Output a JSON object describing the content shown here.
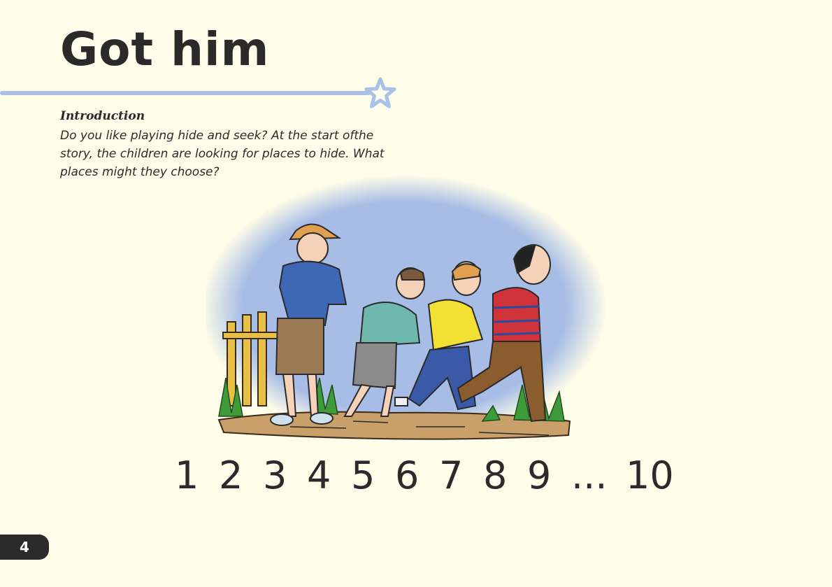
{
  "page": {
    "title": "Got him",
    "page_number": "4"
  },
  "introduction": {
    "heading": "Introduction",
    "text": "Do you like playing hide and seek? At the start ofthe story, the children are looking for places to hide. What places might they choose?"
  },
  "counting": [
    "1",
    "2",
    "3",
    "4",
    "5",
    "6",
    "7",
    "8",
    "9",
    "...",
    "10"
  ],
  "colors": {
    "background": "#fefde9",
    "accent_blue": "#aac0e6",
    "text": "#2a2a2a"
  }
}
